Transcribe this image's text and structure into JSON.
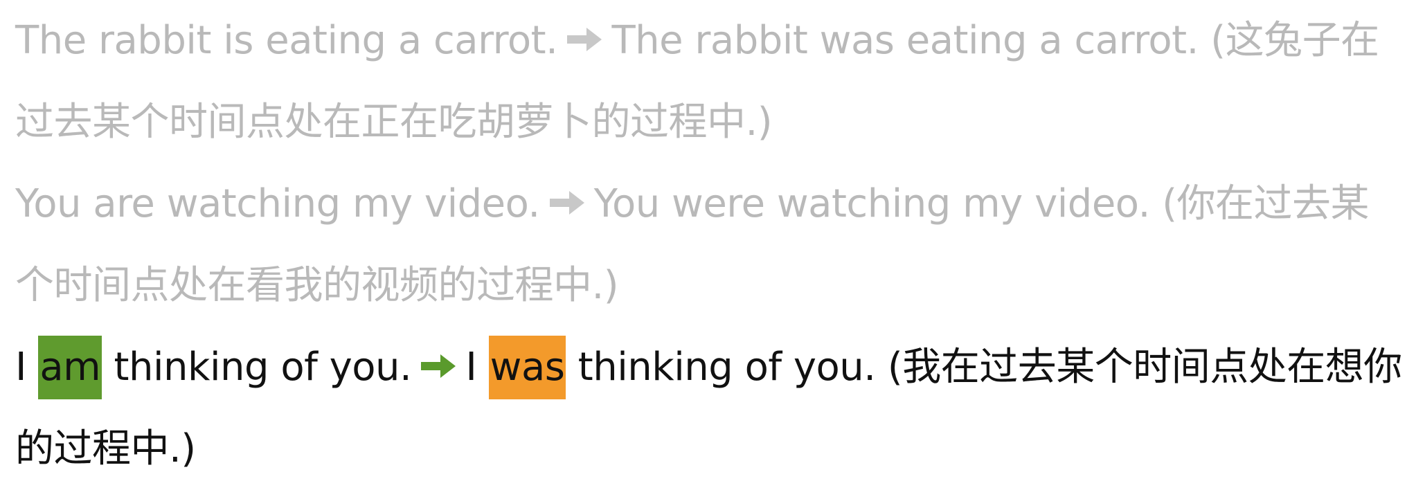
{
  "colors": {
    "faded_text": "#b9b9b9",
    "active_text": "#111111",
    "faded_arrow": "#c8c8c8",
    "active_arrow": "#5a9a2c",
    "highlight_present": "#5f9b2e",
    "highlight_past": "#f39a2b"
  },
  "examples": [
    {
      "before": "The rabbit is eating a carrot.",
      "after": "The rabbit was eating a carrot.",
      "translation": "(这兔子在过去某个时间点处在正在吃胡萝卜的过程中.)"
    },
    {
      "before": "You are watching my video.",
      "after": "You were watching my video.",
      "translation": "(你在过去某个时间点处在看我的视频的过程中.)"
    },
    {
      "before_pre": "I",
      "before_highlight": "am",
      "before_post": "thinking of you.",
      "after_pre": "I",
      "after_highlight": "was",
      "after_post": "thinking of you.",
      "translation": "(我在过去某个时间点处在想你的过程中.)"
    }
  ],
  "icons": {
    "arrow": "right-arrow-icon"
  }
}
